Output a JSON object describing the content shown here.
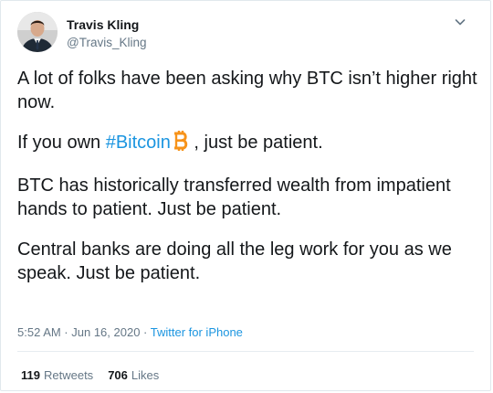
{
  "author": {
    "name": "Travis Kling",
    "handle": "@Travis_Kling"
  },
  "tweet": {
    "p1": "A lot of folks have been asking why BTC isn’t higher right now.",
    "p2_prefix": "If you own ",
    "p2_hashtag": "#Bitcoin",
    "p2_suffix": " , just be patient.",
    "p3": "BTC has historically transferred wealth from impatient hands to patient. Just be patient.",
    "p4": "Central banks are doing all the leg work for you as we speak. Just be patient.",
    "emoji": "bitcoin-emoji"
  },
  "meta": {
    "timestamp": "5:52 AM · Jun 16, 2020 · ",
    "source": "Twitter for iPhone"
  },
  "stats": {
    "retweets_count": "119",
    "retweets_label": "Retweets",
    "likes_count": "706",
    "likes_label": "Likes"
  },
  "colors": {
    "link": "#1b95e0",
    "secondary_text": "#657786",
    "bitcoin_orange": "#f7931a"
  }
}
